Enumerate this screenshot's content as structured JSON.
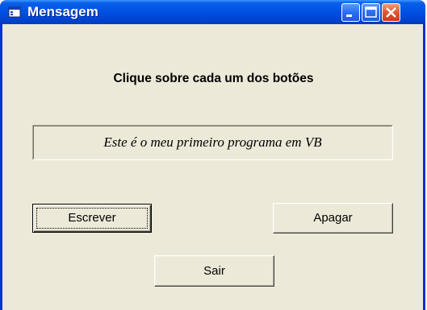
{
  "window": {
    "title": "Mensagem",
    "icon": "app-window-icon",
    "controls": [
      "minimize-icon",
      "maximize-icon",
      "close-icon"
    ]
  },
  "form": {
    "heading": "Clique sobre cada um dos botões",
    "message": "Este é o meu primeiro programa em VB",
    "buttons": {
      "write": "Escrever",
      "clear": "Apagar",
      "exit": "Sair"
    }
  },
  "colors": {
    "title_bar": "#0055e5",
    "client_background": "#ece9d8",
    "close_button": "#e2582c"
  }
}
